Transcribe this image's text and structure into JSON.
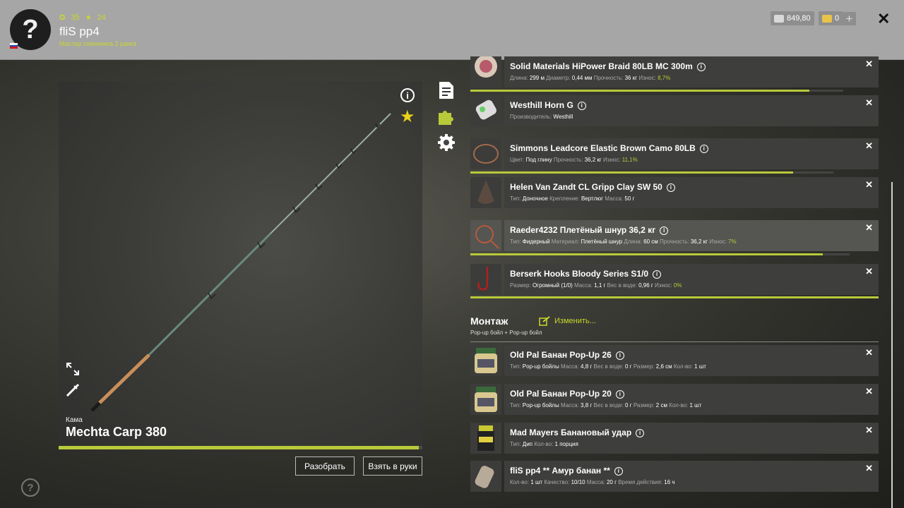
{
  "header": {
    "avatar_glyph": "?",
    "stat_coins": "35",
    "stat_stars": "24",
    "player_name": "fliS pp4",
    "rank": "Мастер спиннинга 2 ранга",
    "silver": "849,80",
    "gold": "0",
    "plus": "+",
    "close": "✕"
  },
  "rod": {
    "brand": "Кама",
    "name": "Mechta Carp 380",
    "condition": 0.99,
    "btn_disassemble": "Разобрать",
    "btn_take": "Взять в руки"
  },
  "items": [
    {
      "name": "Solid Materials HiPower Braid 80LB MC 300m",
      "props": [
        [
          "Длина:",
          "299 м"
        ],
        [
          "Диаметр:",
          "0,44 мм"
        ],
        [
          "Прочность:",
          "36 кг"
        ],
        [
          "Износ:",
          "8,7%",
          "g"
        ]
      ],
      "wear": 0.91
    },
    {
      "name": "Westhill Horn G",
      "props": [
        [
          "Производитель:",
          "Westhill"
        ]
      ]
    },
    {
      "name": "Simmons Leadcore Elastic Brown Camo 80LB",
      "props": [
        [
          "Цвет:",
          "Под глину"
        ],
        [
          "Прочность:",
          "36,2 кг"
        ],
        [
          "Износ:",
          "11,1%",
          "g"
        ]
      ],
      "wear": 0.89
    },
    {
      "name": "Helen Van Zandt CL Gripp Clay SW 50",
      "props": [
        [
          "Тип:",
          "Доночное"
        ],
        [
          "Крепление:",
          "Вертлюг"
        ],
        [
          "Масса:",
          "50 г"
        ]
      ]
    },
    {
      "name": "Raeder4232 Плетёный шнур 36,2 кг",
      "props": [
        [
          "Тип:",
          "Фидерный"
        ],
        [
          "Материал:",
          "Плетёный шнур"
        ],
        [
          "Длина:",
          "60 см"
        ],
        [
          "Прочность:",
          "36,2 кг"
        ],
        [
          "Износ:",
          "7%",
          "g"
        ]
      ],
      "wear": 0.93
    },
    {
      "name": "Berserk Hooks Bloody Series S1/0",
      "props": [
        [
          "Размер:",
          "Огромный (1/0)"
        ],
        [
          "Масса:",
          "1,1 г"
        ],
        [
          "Вес в воде:",
          "0,96 г"
        ],
        [
          "Износ:",
          "0%",
          "g"
        ]
      ]
    }
  ],
  "montage": {
    "title": "Монтаж",
    "edit": "Изменить...",
    "subtitle": "Pop-up бойл + Pop-up бойл"
  },
  "baits": [
    {
      "name": "Old Pal Банан Pop-Up 26",
      "props": [
        [
          "Тип:",
          "Pop-up бойлы"
        ],
        [
          "Масса:",
          "4,8 г"
        ],
        [
          "Вес в воде:",
          "0 г"
        ],
        [
          "Размер:",
          "2,6 см"
        ],
        [
          "Кол-во:",
          "1 шт"
        ]
      ]
    },
    {
      "name": "Old Pal Банан Pop-Up 20",
      "props": [
        [
          "Тип:",
          "Pop-up бойлы"
        ],
        [
          "Масса:",
          "3,8 г"
        ],
        [
          "Вес в воде:",
          "0 г"
        ],
        [
          "Размер:",
          "2 см"
        ],
        [
          "Кол-во:",
          "1 шт"
        ]
      ]
    },
    {
      "name": "Mad Mayers Банановый удар",
      "props": [
        [
          "Тип:",
          "Дип"
        ],
        [
          "Кол-во:",
          "1 порция"
        ]
      ]
    },
    {
      "name": "fliS pp4 ** Амур банан **",
      "props": [
        [
          "Кол-во:",
          "1 шт"
        ],
        [
          "Качество:",
          "10/10"
        ],
        [
          "Масса:",
          "20 г"
        ],
        [
          "Время действия:",
          "16 ч"
        ]
      ]
    }
  ],
  "colors": {
    "accent": "#b8c93a",
    "header": "#a6a6a6"
  }
}
